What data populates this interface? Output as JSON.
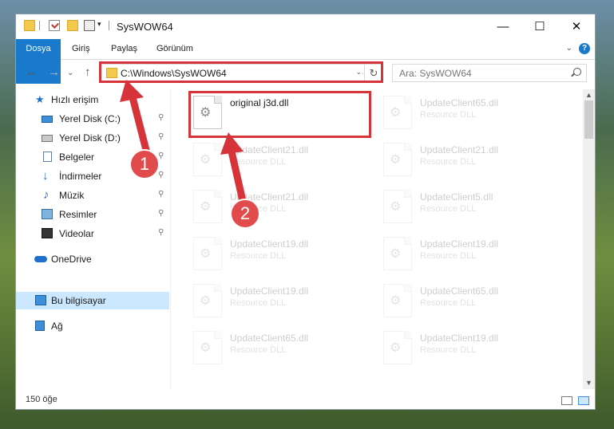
{
  "window": {
    "title": "SysWOW64",
    "controls": {
      "minimize": "—",
      "maximize": "☐",
      "close": "✕"
    }
  },
  "quick_access_toolbar": {
    "dropdown_glyph": "▾",
    "icons": [
      "folder-icon",
      "properties-check-icon",
      "new-folder-icon",
      "properties-icon"
    ]
  },
  "ribbon": {
    "tabs": [
      "Dosya",
      "Giriş",
      "Paylaş",
      "Görünüm"
    ],
    "collapse_glyph": "⌄",
    "help_glyph": "?",
    "file_tab_color": "#1979ca"
  },
  "navigation": {
    "back_glyph": "←",
    "forward_glyph": "→",
    "recent_glyph": "⌄",
    "up_glyph": "↑",
    "address": "C:\\Windows\\SysWOW64",
    "address_dropdown_glyph": "⌄",
    "refresh_glyph": "↻",
    "search_placeholder": "Ara: SysWOW64"
  },
  "sidebar": {
    "items": [
      {
        "label": "Hızlı erişim",
        "icon": "star-icon",
        "pinned": false
      },
      {
        "label": "Yerel Disk (C:)",
        "icon": "windows-drive-icon",
        "pinned": true
      },
      {
        "label": "Yerel Disk (D:)",
        "icon": "drive-icon",
        "pinned": true
      },
      {
        "label": "Belgeler",
        "icon": "documents-icon",
        "pinned": true
      },
      {
        "label": "İndirmeler",
        "icon": "downloads-icon",
        "pinned": true
      },
      {
        "label": "Müzik",
        "icon": "music-icon",
        "pinned": true
      },
      {
        "label": "Resimler",
        "icon": "pictures-icon",
        "pinned": true
      },
      {
        "label": "Videolar",
        "icon": "videos-icon",
        "pinned": true
      },
      {
        "label": "OneDrive",
        "icon": "onedrive-icon",
        "pinned": false
      },
      {
        "label": "Bu bilgisayar",
        "icon": "this-pc-icon",
        "pinned": false,
        "selected": true
      },
      {
        "label": "Ağ",
        "icon": "network-icon",
        "pinned": false
      }
    ],
    "pin_glyph": "📌",
    "selected_color": "#cce8ff"
  },
  "files": [
    {
      "name": "original j3d.dll",
      "type": "",
      "highlighted": true
    },
    {
      "name": "UpdateClient65.dll",
      "type": "Resource DLL"
    },
    {
      "name": "UpdateClient21.dll",
      "type": "Resource DLL"
    },
    {
      "name": "UpdateClient21.dll",
      "type": "Resource DLL"
    },
    {
      "name": "UpdateClient21.dll",
      "type": "Resource DLL"
    },
    {
      "name": "UpdateClient5.dll",
      "type": "Resource DLL"
    },
    {
      "name": "UpdateClient19.dll",
      "type": "Resource DLL"
    },
    {
      "name": "UpdateClient19.dll",
      "type": "Resource DLL"
    },
    {
      "name": "UpdateClient19.dll",
      "type": "Resource DLL"
    },
    {
      "name": "UpdateClient65.dll",
      "type": "Resource DLL"
    },
    {
      "name": "UpdateClient65.dll",
      "type": "Resource DLL"
    },
    {
      "name": "UpdateClient19.dll",
      "type": "Resource DLL"
    }
  ],
  "annotations": {
    "step1": "1",
    "step2": "2",
    "color": "#d7333b"
  },
  "status": {
    "item_count": "150 öğe"
  }
}
